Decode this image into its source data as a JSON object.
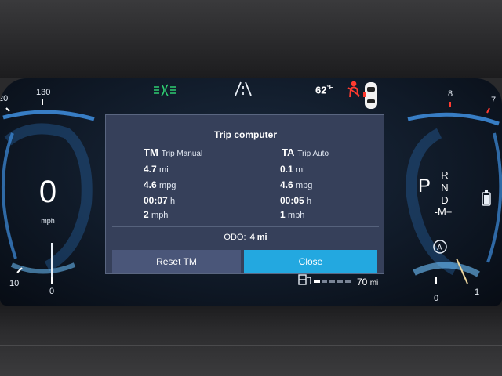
{
  "status_bar": {
    "temperature": "62",
    "temperature_unit": "°F"
  },
  "speedometer": {
    "value": "0",
    "unit": "mph",
    "tick_labels": [
      "20",
      "130",
      "10",
      "0"
    ]
  },
  "tachometer": {
    "tick_labels": [
      "8",
      "7",
      "0",
      "1"
    ]
  },
  "gear": {
    "current": "P",
    "options": [
      "R",
      "N",
      "D"
    ],
    "mode": "-M+"
  },
  "trip_computer": {
    "title": "Trip computer",
    "manual": {
      "abbr": "TM",
      "label": "Trip Manual",
      "distance": "4.7",
      "distance_unit": "mi",
      "economy": "4.6",
      "economy_unit": "mpg",
      "time": "00:07",
      "time_unit": "h",
      "avg_speed": "2",
      "avg_speed_unit": "mph"
    },
    "auto": {
      "abbr": "TA",
      "label": "Trip Auto",
      "distance": "0.1",
      "distance_unit": "mi",
      "economy": "4.6",
      "economy_unit": "mpg",
      "time": "00:05",
      "time_unit": "h",
      "avg_speed": "1",
      "avg_speed_unit": "mph"
    },
    "odo_label": "ODO:",
    "odo_value": "4 mi",
    "reset_label": "Reset TM",
    "close_label": "Close"
  },
  "range": {
    "value": "70",
    "unit": "mi",
    "battery_level_fraction": 0.15
  },
  "colors": {
    "accent_blue": "#23a8e0",
    "gauge_blue": "#3f8fe0",
    "lights_green": "#2ecc71",
    "warning_red": "#ff3b30"
  },
  "icons": [
    "headlights-icon",
    "lane-assist-icon",
    "seatbelt-warning-icon",
    "car-top-icon",
    "battery-icon",
    "auto-start-stop-icon",
    "charge-plug-icon"
  ]
}
